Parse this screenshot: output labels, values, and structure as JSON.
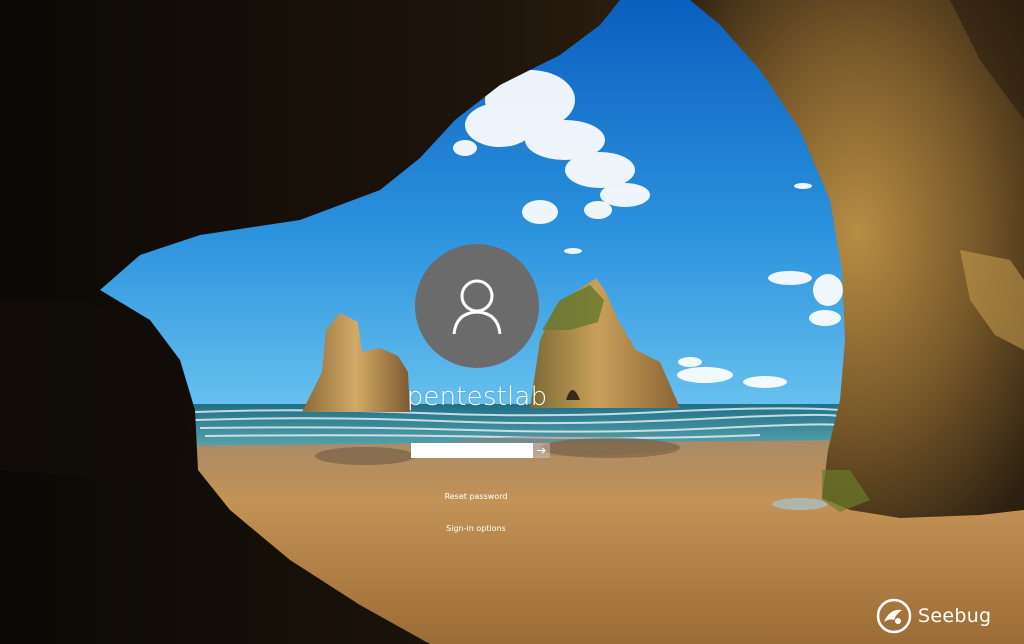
{
  "lock_screen": {
    "wallpaper_icon": "cave-beach-wallpaper",
    "user": {
      "avatar_icon": "user-icon",
      "name": "pentestlab"
    },
    "password": {
      "value": "",
      "placeholder": "",
      "submit_icon": "arrow-right-icon"
    },
    "links": {
      "reset_password": "Reset password",
      "sign_in_options": "Sign-in options"
    }
  },
  "watermark": {
    "logo_icon": "seebug-logo-icon",
    "text": "Seebug"
  },
  "colors": {
    "avatar_bg": "#6b6b6b",
    "sky": "#2a8fd8",
    "sand": "#b78a4c",
    "rock": "#1a1209"
  }
}
